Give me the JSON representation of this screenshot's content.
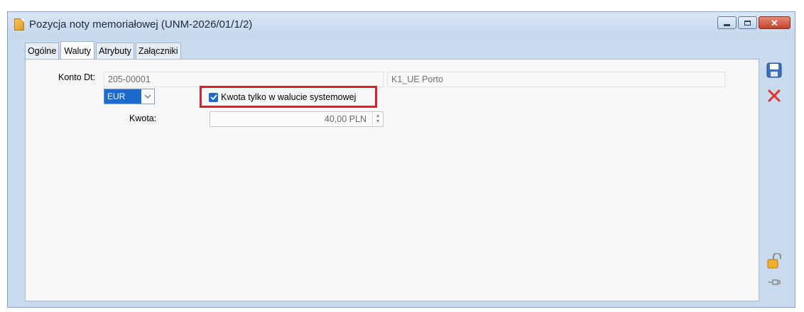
{
  "window": {
    "title": "Pozycja noty memoriałowej (UNM-2026/01/1/2)",
    "buttons": [
      "minimize",
      "maximize",
      "close"
    ]
  },
  "tabs": [
    {
      "label": "Ogólne",
      "active": false
    },
    {
      "label": "Waluty",
      "active": true
    },
    {
      "label": "Atrybuty",
      "active": false
    },
    {
      "label": "Załączniki",
      "active": false
    }
  ],
  "form": {
    "konto_label": "Konto Dt:",
    "konto_value": "205-00001",
    "konto_name": "K1_UE Porto",
    "currency": "EUR",
    "checkbox_label": "Kwota tylko w walucie systemowej",
    "checkbox_checked": true,
    "kwota_label": "Kwota:",
    "kwota_value": "40,00 PLN"
  },
  "sidebar_icons": [
    "save-icon",
    "cancel-icon",
    "unlock-icon",
    "pin-icon"
  ],
  "colors": {
    "accent": "#1a6ad0",
    "highlight": "#d9222e",
    "cancel": "#e0322a"
  }
}
